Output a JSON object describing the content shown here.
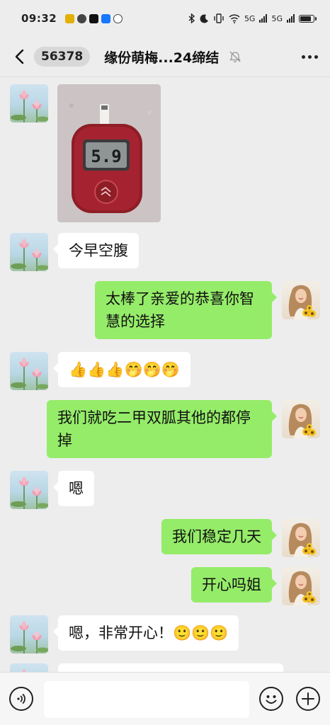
{
  "status_bar": {
    "time": "09:32",
    "network_5g_1": "5G",
    "network_5g_2": "5G",
    "battery_level": 0.85
  },
  "header": {
    "unread_count": "56378",
    "title": "缘份萌梅...24缔结",
    "muted": true
  },
  "messages": [
    {
      "side": "in",
      "type": "image",
      "image": "glucose-meter-photo",
      "meter_reading": "5.9"
    },
    {
      "side": "in",
      "type": "text",
      "text": "今早空腹"
    },
    {
      "side": "out",
      "type": "text",
      "text": "太棒了亲爱的恭喜你智慧的选择"
    },
    {
      "side": "in",
      "type": "text",
      "text": "👍👍👍🤭🤭🤭"
    },
    {
      "side": "out",
      "type": "text",
      "text": "我们就吃二甲双胍其他的都停掉"
    },
    {
      "side": "in",
      "type": "text",
      "text": "嗯"
    },
    {
      "side": "out",
      "type": "text",
      "text": "我们稳定几天"
    },
    {
      "side": "out",
      "type": "text",
      "text": "开心吗姐"
    },
    {
      "side": "in",
      "type": "text",
      "text": "嗯，非常开心！🙂🙂🙂"
    },
    {
      "side": "in",
      "type": "text",
      "text": ""
    }
  ],
  "input_bar": {
    "value": "",
    "placeholder": ""
  },
  "icons": {
    "back": "chevron-left-icon",
    "mute": "bell-off-icon",
    "more": "more-dots-icon",
    "voice": "voice-icon",
    "emoji": "emoji-icon",
    "plus": "plus-icon"
  },
  "colors": {
    "chat_background": "#ededed",
    "incoming_bubble": "#ffffff",
    "outgoing_bubble": "#95ec69",
    "input_bar": "#f6f6f6"
  }
}
